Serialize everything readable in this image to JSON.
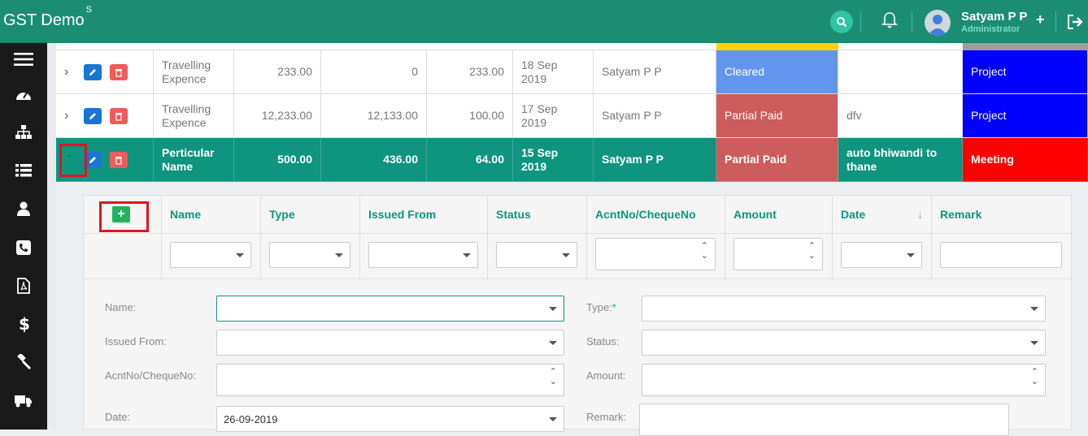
{
  "header": {
    "brand": "GST Demo",
    "brand_sup": "S",
    "user_name": "Satyam P P",
    "user_role": "Administrator",
    "plus": "+"
  },
  "sidebar": {
    "icons": [
      "menu-icon",
      "dashboard-icon",
      "sitemap-icon",
      "list-icon",
      "user-icon",
      "phone-icon",
      "pdf-icon",
      "dollar-icon",
      "gavel-icon",
      "truck-icon"
    ]
  },
  "rows": [
    {
      "particular": "Travelling Expence",
      "amount": "233.00",
      "paid": "0",
      "balance": "233.00",
      "date": "18 Sep 2019",
      "user": "Satyam P P",
      "status": "Cleared",
      "remark": "",
      "type": "Project"
    },
    {
      "particular": "Travelling Expence",
      "amount": "12,233.00",
      "paid": "12,133.00",
      "balance": "100.00",
      "date": "17 Sep 2019",
      "user": "Satyam P P",
      "status": "Partial Paid",
      "remark": "dfv",
      "type": "Project"
    },
    {
      "particular": "Perticular Name",
      "amount": "500.00",
      "paid": "436.00",
      "balance": "64.00",
      "date": "15 Sep 2019",
      "user": "Satyam P P",
      "status": "Partial Paid",
      "remark": "auto bhiwandi to thane",
      "type": "Meeting"
    }
  ],
  "detail": {
    "columns": [
      "Name",
      "Type",
      "Issued From",
      "Status",
      "AcntNo/ChequeNo",
      "Amount",
      "Date",
      "Remark"
    ],
    "add_label": "+",
    "form": {
      "name_label": "Name:",
      "type_label": "Type:",
      "type_required": "*",
      "issued_label": "Issued From:",
      "status_label": "Status:",
      "acnt_label": "AcntNo/ChequeNo:",
      "amount_label": "Amount:",
      "date_label": "Date:",
      "date_value": "26-09-2019",
      "remark_label": "Remark:"
    }
  },
  "colors": {
    "header": "#1b8d73",
    "selected_row": "#0f9480",
    "cleared": "#6495ed",
    "partial": "#cd5c5c",
    "project": "#0000ff",
    "meeting": "#ff0000"
  }
}
